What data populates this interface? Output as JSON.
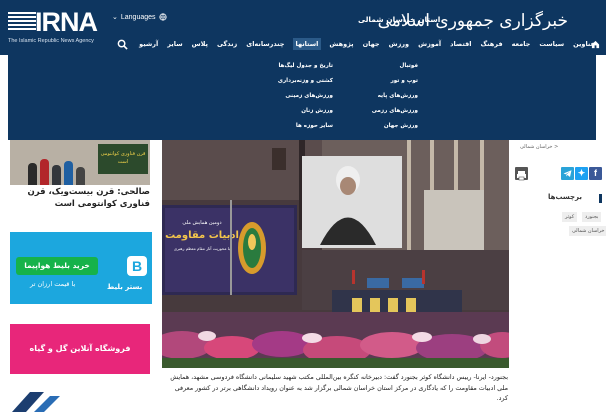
{
  "header": {
    "logo_text": "IRNA",
    "logo_subtitle": "The Islamic Republic News Agency",
    "languages_label": "Languages",
    "site_name": "خبرگزاری جمهوری اسلامی",
    "province_name": "استان خراسان شمالی"
  },
  "nav": {
    "items": [
      "عناوین",
      "سیاست",
      "جامعه",
      "فرهنگ",
      "اقتصاد",
      "آموزش",
      "ورزش",
      "جهان",
      "پژوهش",
      "استانها",
      "چندرسانه‌ای",
      "زندگی",
      "پلاس",
      "سایر",
      "آرشیو"
    ],
    "active_index": 9
  },
  "dropdown": {
    "col1": [
      "فوتبال",
      "توپ و تور",
      "ورزش‌های پایه",
      "ورزش‌های رزمی",
      "ورزش جهان"
    ],
    "col2": [
      "تاریخ و جدول لیگ‌ها",
      "کشتی و وزنه‌برداری",
      "ورزش‌های زمینی",
      "ورزش زنان",
      "سایر حوزه ها"
    ]
  },
  "left_column": {
    "ad_top_text": "قرن فناوری کوانتومی است",
    "headline": "صالحی: قرن بیست‌ویک، قرن فناوری کوانتومی است",
    "flight_ad": {
      "button": "خرید بلیط هواپیما",
      "sub": "با قیمت ارزان تر",
      "logo_letter": "B",
      "brand": "بستر بلیط"
    },
    "flower_ad": "فروشگاه آنلاین گل و گیاه"
  },
  "photo": {
    "poster_small": "دومین همایش ملی",
    "poster_title": "ادبیات مقاومت",
    "poster_sub": "با محوریت آثار مقام معظم رهبری"
  },
  "caption": "بجنورد- ایرنا- رییس دانشگاه کوثر بجنورد گفت: دبیرخانه کنگره بین‌المللی مکتب شهید سلیمانی دانشگاه فردوسی مشهد، همایش ملی ادبیات مقاومت را که یادگاری در مرکز استان خراسان شمالی برگزار شد به عنوان رویداد دانشگاهی برتر در کشور معرفی کرد.",
  "right_column": {
    "breadcrumb": "< خراسان شمالی",
    "tags_title": "برچسب‌ها",
    "tags": [
      "بجنورد",
      "کوثر",
      "خراسان شمالی"
    ],
    "share_colors": {
      "telegram": "#2aa3d8",
      "twitter": "#1da1f2",
      "facebook": "#3b5998"
    }
  }
}
